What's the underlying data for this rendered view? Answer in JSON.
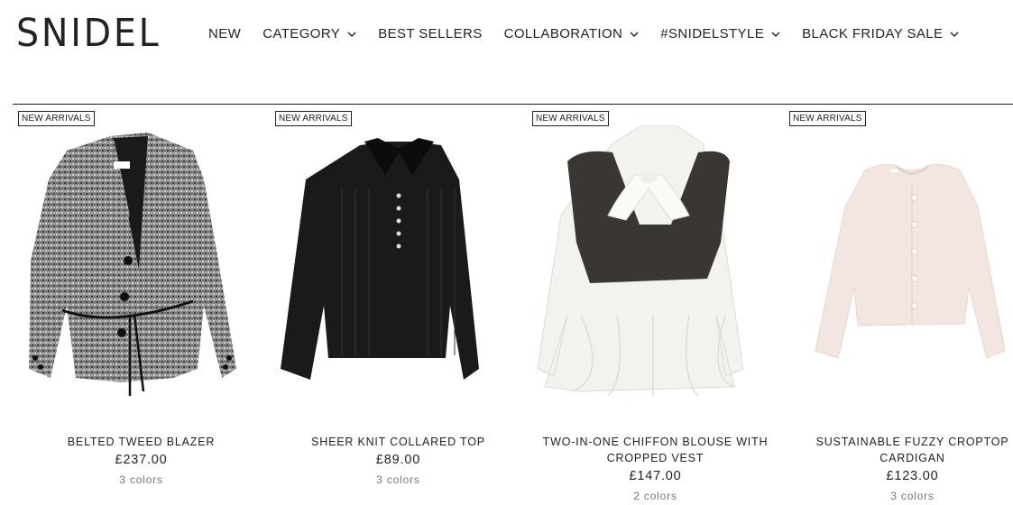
{
  "header": {
    "logo": "SNIDEL",
    "nav": [
      {
        "label": "NEW",
        "has_dropdown": false
      },
      {
        "label": "CATEGORY",
        "has_dropdown": true
      },
      {
        "label": "BEST SELLERS",
        "has_dropdown": false
      },
      {
        "label": "COLLABORATION",
        "has_dropdown": true
      },
      {
        "label": "#SNIDELSTYLE",
        "has_dropdown": true
      },
      {
        "label": "BLACK FRIDAY SALE",
        "has_dropdown": true
      }
    ]
  },
  "products": [
    {
      "badge": "NEW ARRIVALS",
      "name": "BELTED TWEED BLAZER",
      "price": "£237.00",
      "colors": "3 colors",
      "image": "tweed-blazer-image"
    },
    {
      "badge": "NEW ARRIVALS",
      "name": "SHEER KNIT COLLARED TOP",
      "price": "£89.00",
      "colors": "3 colors",
      "image": "knit-top-image"
    },
    {
      "badge": "NEW ARRIVALS",
      "name": "TWO-IN-ONE CHIFFON BLOUSE WITH CROPPED VEST",
      "price": "£147.00",
      "colors": "2 colors",
      "image": "chiffon-blouse-image"
    },
    {
      "badge": "NEW ARRIVALS",
      "name": "SUSTAINABLE FUZZY CROPTOP CARDIGAN",
      "price": "£123.00",
      "colors": "3 colors",
      "image": "cardigan-image"
    }
  ]
}
